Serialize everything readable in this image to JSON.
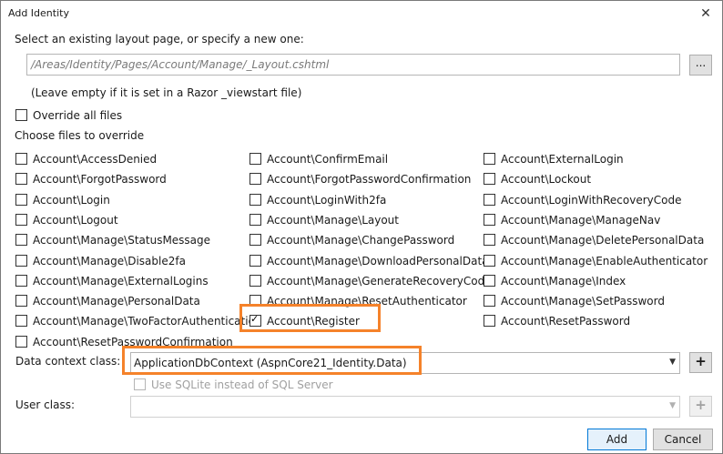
{
  "dialog": {
    "title": "Add Identity",
    "close_glyph": "✕"
  },
  "layout": {
    "prompt": "Select an existing layout page, or specify a new one:",
    "path_value": "/Areas/Identity/Pages/Account/Manage/_Layout.cshtml",
    "browse_label": "...",
    "hint": "(Leave empty if it is set in a Razor _viewstart file)"
  },
  "override_all": {
    "label": "Override all files",
    "checked": false
  },
  "choose_label": "Choose files to override",
  "files": [
    {
      "label": "Account\\AccessDenied",
      "checked": false
    },
    {
      "label": "Account\\ConfirmEmail",
      "checked": false
    },
    {
      "label": "Account\\ExternalLogin",
      "checked": false
    },
    {
      "label": "Account\\ForgotPassword",
      "checked": false
    },
    {
      "label": "Account\\ForgotPasswordConfirmation",
      "checked": false
    },
    {
      "label": "Account\\Lockout",
      "checked": false
    },
    {
      "label": "Account\\Login",
      "checked": false
    },
    {
      "label": "Account\\LoginWith2fa",
      "checked": false
    },
    {
      "label": "Account\\LoginWithRecoveryCode",
      "checked": false
    },
    {
      "label": "Account\\Logout",
      "checked": false
    },
    {
      "label": "Account\\Manage\\Layout",
      "checked": false
    },
    {
      "label": "Account\\Manage\\ManageNav",
      "checked": false
    },
    {
      "label": "Account\\Manage\\StatusMessage",
      "checked": false
    },
    {
      "label": "Account\\Manage\\ChangePassword",
      "checked": false
    },
    {
      "label": "Account\\Manage\\DeletePersonalData",
      "checked": false
    },
    {
      "label": "Account\\Manage\\Disable2fa",
      "checked": false
    },
    {
      "label": "Account\\Manage\\DownloadPersonalData",
      "checked": false
    },
    {
      "label": "Account\\Manage\\EnableAuthenticator",
      "checked": false
    },
    {
      "label": "Account\\Manage\\ExternalLogins",
      "checked": false
    },
    {
      "label": "Account\\Manage\\GenerateRecoveryCode",
      "checked": false
    },
    {
      "label": "Account\\Manage\\Index",
      "checked": false
    },
    {
      "label": "Account\\Manage\\PersonalData",
      "checked": false
    },
    {
      "label": "Account\\Manage\\ResetAuthenticator",
      "checked": false
    },
    {
      "label": "Account\\Manage\\SetPassword",
      "checked": false
    },
    {
      "label": "Account\\Manage\\TwoFactorAuthenticatio",
      "checked": false
    },
    {
      "label": "Account\\Register",
      "checked": true
    },
    {
      "label": "Account\\ResetPassword",
      "checked": false
    },
    {
      "label": "Account\\ResetPasswordConfirmation",
      "checked": false
    }
  ],
  "data_context": {
    "label": "Data context class:",
    "value": "ApplicationDbContext (AspnCore21_Identity.Data)",
    "add_label": "+"
  },
  "sqlite": {
    "label": "Use SQLite instead of SQL Server",
    "checked": false
  },
  "user_class": {
    "label": "User class:",
    "value": "",
    "add_label": "+"
  },
  "buttons": {
    "add": "Add",
    "cancel": "Cancel"
  },
  "colors": {
    "highlight": "#f5822a",
    "accent": "#0078d7"
  }
}
